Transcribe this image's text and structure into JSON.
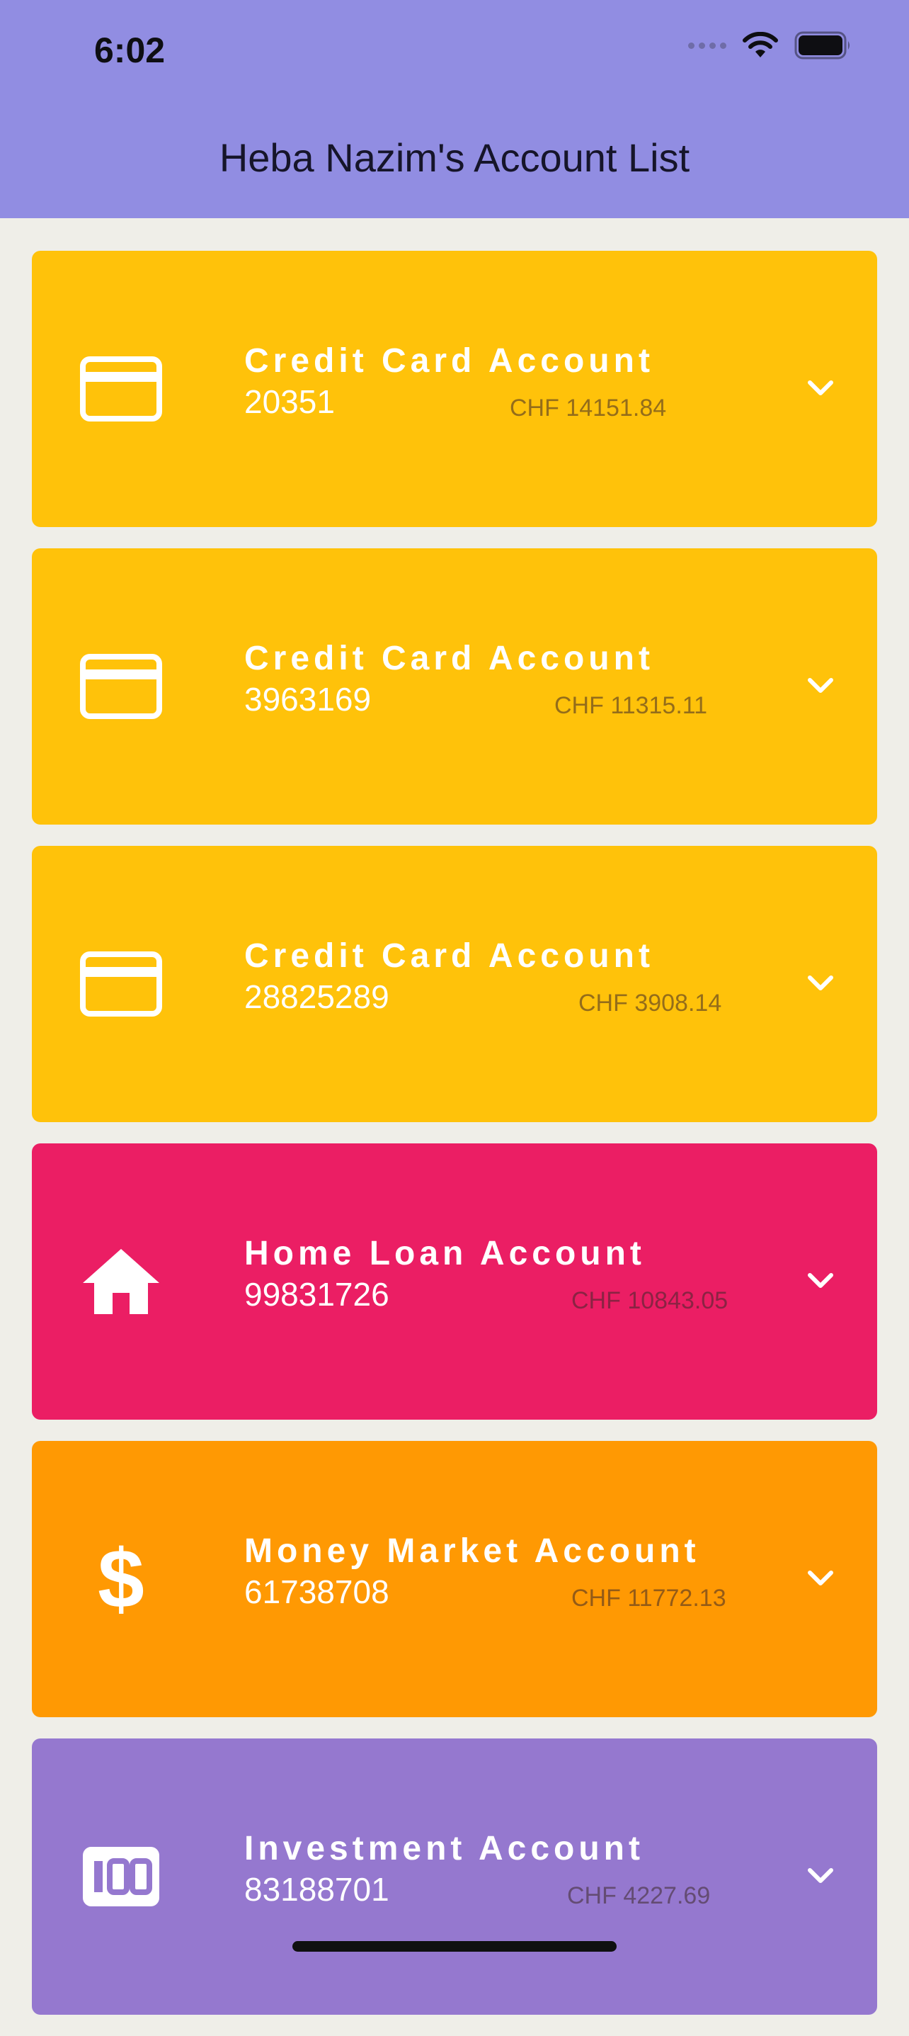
{
  "status_bar": {
    "time": "6:02"
  },
  "header": {
    "title": "Heba Nazim's Account List"
  },
  "colors": {
    "header": "#918DE2",
    "background": "#EFEEE8",
    "credit_card": "#FFC20A",
    "home_loan": "#EB1E64",
    "money_market": "#FF9903",
    "investment": "#9578CF"
  },
  "accounts": [
    {
      "type": "Credit Card Account",
      "number": "20351",
      "balance": "CHF 14151.84",
      "icon": "credit-card-icon"
    },
    {
      "type": "Credit Card Account",
      "number": "3963169",
      "balance": "CHF 11315.11",
      "icon": "credit-card-icon"
    },
    {
      "type": "Credit Card Account",
      "number": "28825289",
      "balance": "CHF 3908.14",
      "icon": "credit-card-icon"
    },
    {
      "type": "Home Loan Account",
      "number": "99831726",
      "balance": "CHF 10843.05",
      "icon": "home-icon"
    },
    {
      "type": "Money Market Account",
      "number": "61738708",
      "balance": "CHF 11772.13",
      "icon": "dollar-icon"
    },
    {
      "type": "Investment Account",
      "number": "83188701",
      "balance": "CHF 4227.69",
      "icon": "hundred-icon"
    }
  ]
}
